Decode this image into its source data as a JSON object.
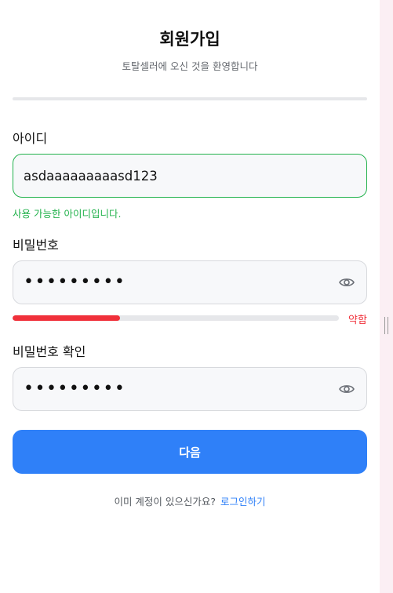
{
  "header": {
    "title": "회원가입",
    "subtitle": "토탈셀러에 오신 것을 환영합니다"
  },
  "id_field": {
    "label": "아이디",
    "value": "asdaaaaaaaaasd123",
    "status": "사용 가능한 아이디입니다."
  },
  "password_field": {
    "label": "비밀번호",
    "masked_value": "•••••••••",
    "strength_label": "약함",
    "strength_level": 0.33
  },
  "password_confirm_field": {
    "label": "비밀번호 확인",
    "masked_value": "•••••••••"
  },
  "actions": {
    "next_label": "다음"
  },
  "footer": {
    "prompt": "이미 계정이 있으신가요?",
    "login_link": "로그인하기"
  },
  "colors": {
    "primary": "#2f80f8",
    "success": "#22b24c",
    "danger": "#f0303a"
  },
  "icons": {
    "password_toggle": "eye-icon"
  }
}
